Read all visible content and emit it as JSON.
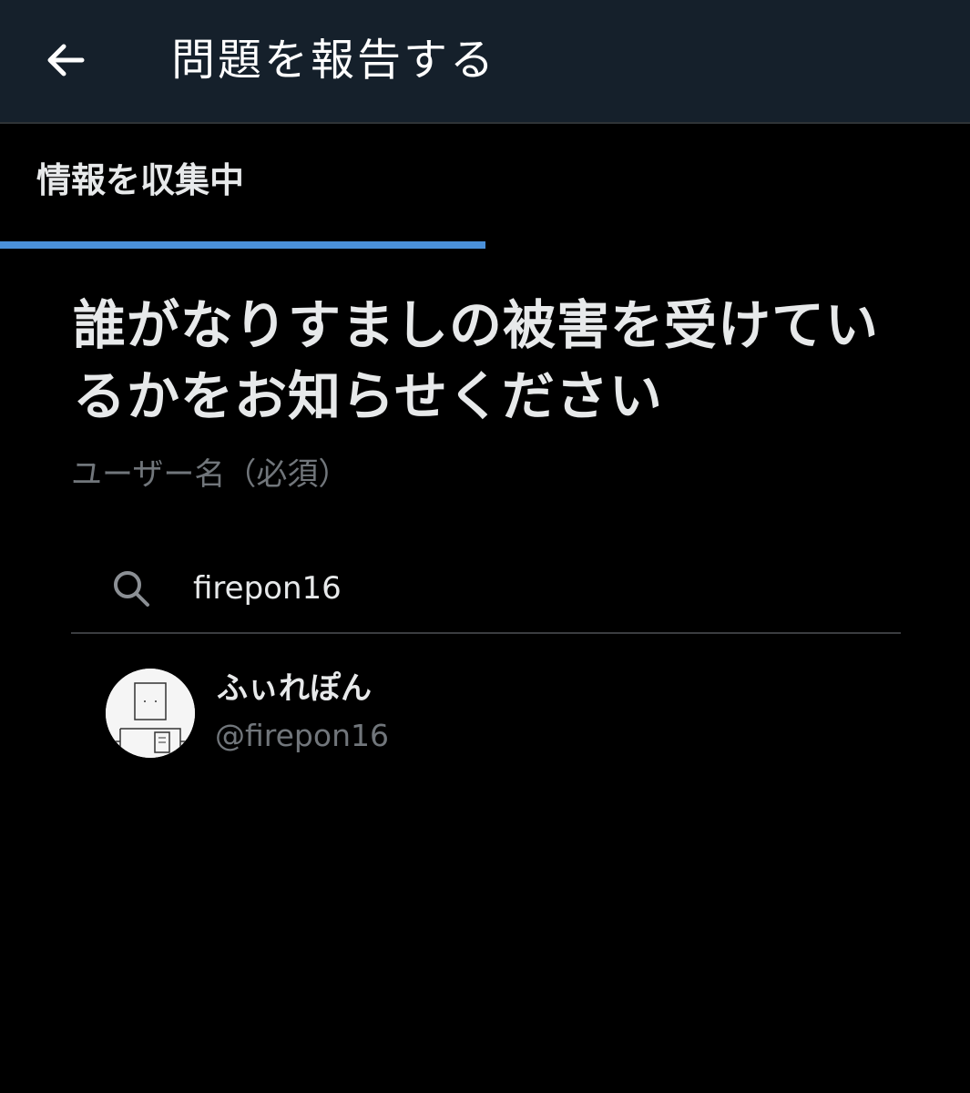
{
  "header": {
    "title": "問題を報告する",
    "back_icon": "arrow-left-icon"
  },
  "step": {
    "label": "情報を収集中",
    "progress": 0.5,
    "progress_color": "#4a90d9"
  },
  "main": {
    "heading": "誰がなりすましの被害を受けているかをお知らせください",
    "field_label": "ユーザー名（必須）"
  },
  "search": {
    "icon": "search-icon",
    "value": "firepon16"
  },
  "results": [
    {
      "display_name": "ふぃれぽん",
      "handle": "@firepon16",
      "avatar_icon": "robot-sketch-avatar"
    }
  ],
  "colors": {
    "background": "#000000",
    "header_background": "#15202b",
    "primary_text": "#e7e9ea",
    "secondary_text": "#71767b",
    "accent": "#4a90d9"
  }
}
